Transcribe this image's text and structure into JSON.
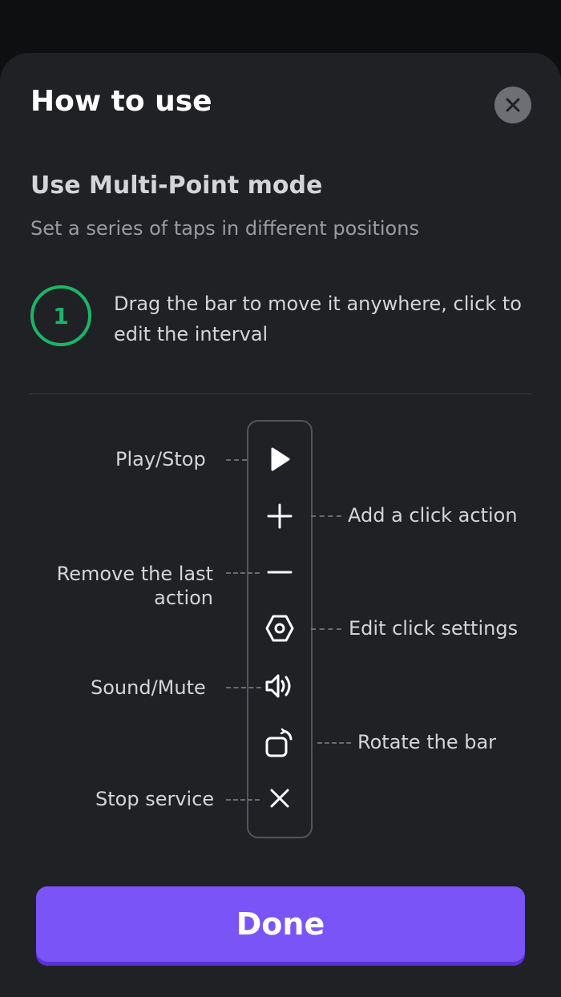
{
  "dialog": {
    "title": "How to use",
    "close_icon": "close-icon"
  },
  "mode": {
    "title": "Use Multi-Point mode",
    "subtitle": "Set a series of taps in different positions"
  },
  "step": {
    "number": "1",
    "text": "Drag the bar to move it anywhere, click to edit the interval"
  },
  "toolbar": {
    "items": [
      {
        "icon": "play-icon",
        "label": "Play/Stop"
      },
      {
        "icon": "plus-icon",
        "label": "Add a click action"
      },
      {
        "icon": "minus-icon",
        "label_line1": "Remove the last",
        "label_line2": "action"
      },
      {
        "icon": "hexagon-settings-icon",
        "label": "Edit click settings"
      },
      {
        "icon": "speaker-icon",
        "label": "Sound/Mute"
      },
      {
        "icon": "rotate-icon",
        "label": "Rotate the bar"
      },
      {
        "icon": "close-icon",
        "label": "Stop service"
      }
    ]
  },
  "done_label": "Done",
  "colors": {
    "accent": "#7b54f7",
    "step_green": "#1bb56a",
    "sheet_bg": "#202125"
  }
}
